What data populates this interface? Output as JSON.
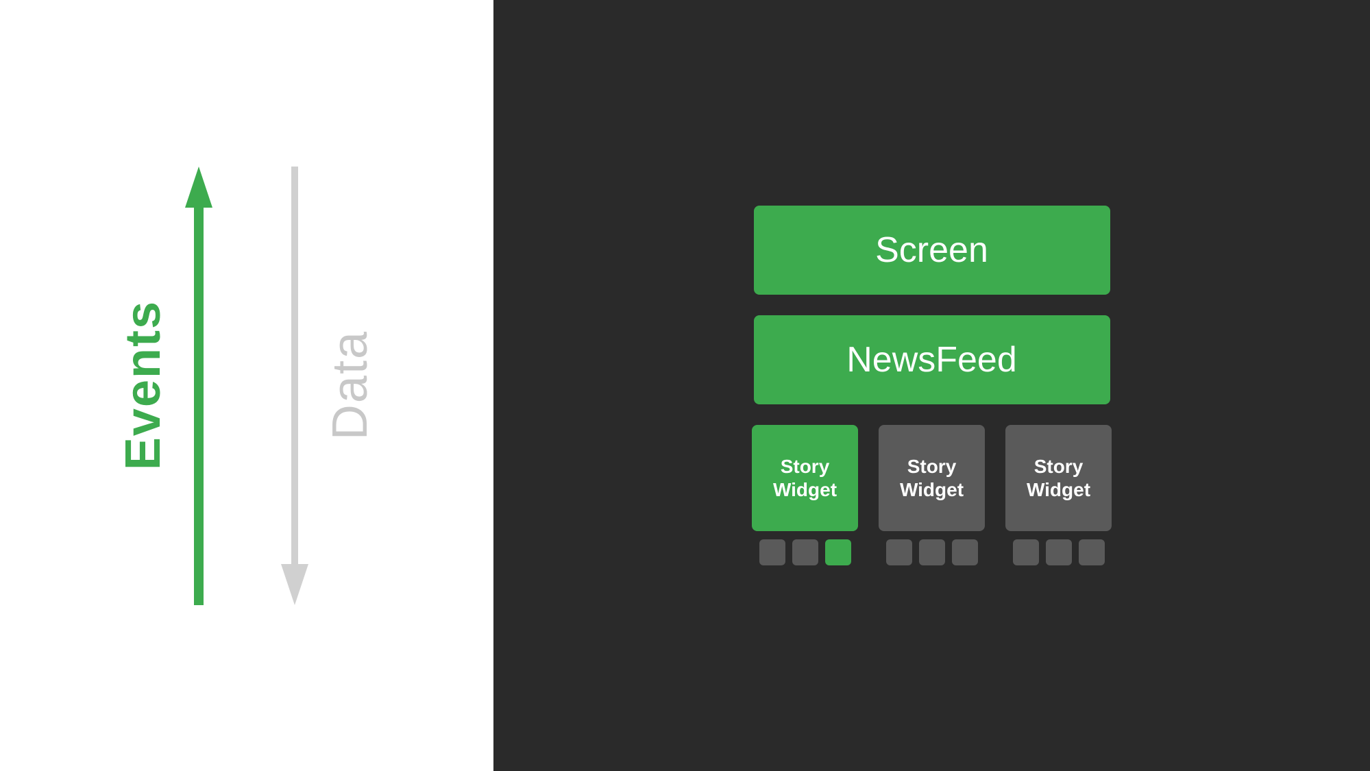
{
  "left": {
    "events_label": "Events",
    "data_label": "Data"
  },
  "right": {
    "screen_label": "Screen",
    "newsfeed_label": "NewsFeed",
    "story_widget_1": "Story\nWidget",
    "story_widget_2": "Story\nWidget",
    "story_widget_3": "Story\nWidget",
    "story_widgets_label": "Story Widget"
  },
  "colors": {
    "green": "#3dab4e",
    "gray": "#5a5a5a",
    "white": "#ffffff",
    "dark_bg": "#2a2a2a",
    "light_gray_text": "#c8c8c8"
  }
}
